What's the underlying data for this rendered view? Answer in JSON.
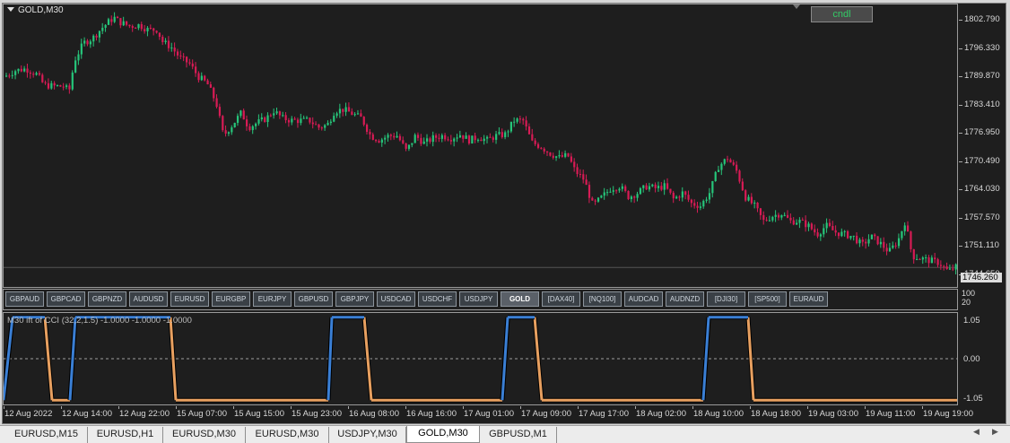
{
  "window": {
    "symbol_title": "GOLD,M30"
  },
  "controls": {
    "cndl_label": "cndl"
  },
  "price_axis": {
    "labels": [
      "1802.790",
      "1796.330",
      "1789.870",
      "1783.410",
      "1776.950",
      "1770.490",
      "1764.030",
      "1757.570",
      "1751.110",
      "1744.650"
    ],
    "current_price": "1746.260"
  },
  "symbol_bar": {
    "buttons": [
      "GBPAUD",
      "GBPCAD",
      "GBPNZD",
      "AUDUSD",
      "EURUSD",
      "EURGBP",
      "EURJPY",
      "GBPUSD",
      "GBPJPY",
      "USDCAD",
      "USDCHF",
      "USDJPY",
      "GOLD",
      "[DAX40]",
      "[NQ100]",
      "AUDCAD",
      "AUDNZD",
      "[DJI30]",
      "[SP500]",
      "EURAUD"
    ],
    "active": "GOLD",
    "axis_top": "100",
    "axis_bottom": "20"
  },
  "indicator": {
    "title": "M30 ift of CCI (32,2,1.5) -1.0000 -1.0000 -1.0000",
    "labels": [
      "1.05",
      "0.00",
      "-1.05"
    ],
    "colors": {
      "up": "#3a7fd5",
      "down": "#e8a060"
    }
  },
  "time_axis": {
    "labels": [
      "12 Aug 2022",
      "12 Aug 14:00",
      "12 Aug 22:00",
      "15 Aug 07:00",
      "15 Aug 15:00",
      "15 Aug 23:00",
      "16 Aug 08:00",
      "16 Aug 16:00",
      "17 Aug 01:00",
      "17 Aug 09:00",
      "17 Aug 17:00",
      "18 Aug 02:00",
      "18 Aug 10:00",
      "18 Aug 18:00",
      "19 Aug 03:00",
      "19 Aug 11:00",
      "19 Aug 19:00"
    ]
  },
  "tabs": {
    "items": [
      "EURUSD,M15",
      "EURUSD,H1",
      "EURUSD,M30",
      "EURUSD,M30",
      "USDJPY,M30",
      "GOLD,M30",
      "GBPUSD,M1"
    ],
    "active_index": 5
  },
  "chart_data": {
    "type": "candlestick",
    "colors": {
      "bull": "#26c57a",
      "bear": "#d81b55"
    },
    "ylim": [
      1744.65,
      1802.79
    ],
    "close_path": [
      [
        0,
        1789.8
      ],
      [
        12,
        1791.2
      ],
      [
        24,
        1791.6
      ],
      [
        36,
        1790.3
      ],
      [
        44,
        1787.9
      ],
      [
        56,
        1787.6
      ],
      [
        66,
        1787.6
      ],
      [
        72,
        1786.5
      ],
      [
        78,
        1793.5
      ],
      [
        88,
        1797.5
      ],
      [
        98,
        1798.5
      ],
      [
        108,
        1800.8
      ],
      [
        116,
        1802.3
      ],
      [
        122,
        1803.3
      ],
      [
        128,
        1802.3
      ],
      [
        140,
        1801.3
      ],
      [
        150,
        1801.6
      ],
      [
        160,
        1800.5
      ],
      [
        170,
        1800.5
      ],
      [
        176,
        1797.8
      ],
      [
        186,
        1796.5
      ],
      [
        196,
        1794.0
      ],
      [
        206,
        1792.8
      ],
      [
        216,
        1789.8
      ],
      [
        226,
        1788.2
      ],
      [
        236,
        1783.8
      ],
      [
        244,
        1776.3
      ],
      [
        254,
        1778.8
      ],
      [
        264,
        1781.6
      ],
      [
        272,
        1778.2
      ],
      [
        282,
        1779.3
      ],
      [
        292,
        1780.3
      ],
      [
        300,
        1782.0
      ],
      [
        310,
        1780.3
      ],
      [
        320,
        1779.8
      ],
      [
        330,
        1779.8
      ],
      [
        340,
        1779.8
      ],
      [
        350,
        1778.2
      ],
      [
        360,
        1778.8
      ],
      [
        368,
        1782.0
      ],
      [
        378,
        1782.3
      ],
      [
        388,
        1781.3
      ],
      [
        398,
        1780.3
      ],
      [
        408,
        1776.3
      ],
      [
        418,
        1775.3
      ],
      [
        428,
        1776.3
      ],
      [
        438,
        1776.3
      ],
      [
        448,
        1772.8
      ],
      [
        458,
        1776.3
      ],
      [
        468,
        1774.6
      ],
      [
        478,
        1775.8
      ],
      [
        488,
        1776.3
      ],
      [
        498,
        1775.8
      ],
      [
        508,
        1776.6
      ],
      [
        518,
        1775.3
      ],
      [
        528,
        1776.0
      ],
      [
        538,
        1775.3
      ],
      [
        548,
        1776.3
      ],
      [
        558,
        1776.6
      ],
      [
        568,
        1779.8
      ],
      [
        578,
        1779.8
      ],
      [
        588,
        1774.8
      ],
      [
        598,
        1773.8
      ],
      [
        608,
        1772.3
      ],
      [
        618,
        1771.3
      ],
      [
        628,
        1771.8
      ],
      [
        636,
        1768.3
      ],
      [
        646,
        1766.3
      ],
      [
        656,
        1760.3
      ],
      [
        666,
        1762.3
      ],
      [
        676,
        1764.3
      ],
      [
        686,
        1764.8
      ],
      [
        696,
        1762.3
      ],
      [
        706,
        1763.3
      ],
      [
        716,
        1764.8
      ],
      [
        726,
        1764.3
      ],
      [
        736,
        1764.8
      ],
      [
        746,
        1761.8
      ],
      [
        756,
        1763.3
      ],
      [
        766,
        1760.8
      ],
      [
        776,
        1760.3
      ],
      [
        786,
        1763.3
      ],
      [
        796,
        1769.3
      ],
      [
        806,
        1771.2
      ],
      [
        816,
        1768.3
      ],
      [
        826,
        1762.3
      ],
      [
        836,
        1760.3
      ],
      [
        846,
        1756.8
      ],
      [
        856,
        1758.0
      ],
      [
        866,
        1758.6
      ],
      [
        876,
        1756.8
      ],
      [
        886,
        1756.8
      ],
      [
        896,
        1755.8
      ],
      [
        906,
        1753.8
      ],
      [
        916,
        1755.8
      ],
      [
        926,
        1754.3
      ],
      [
        936,
        1753.8
      ],
      [
        946,
        1753.3
      ],
      [
        956,
        1751.3
      ],
      [
        966,
        1753.3
      ],
      [
        976,
        1751.8
      ],
      [
        986,
        1749.8
      ],
      [
        996,
        1752.3
      ],
      [
        1004,
        1756.8
      ],
      [
        1012,
        1748.8
      ],
      [
        1022,
        1748.3
      ],
      [
        1032,
        1747.8
      ],
      [
        1042,
        1747.3
      ],
      [
        1052,
        1745.3
      ],
      [
        1060,
        1746.3
      ]
    ],
    "indicator_levels": [
      [
        0,
        -1.05
      ],
      [
        10,
        1.05
      ],
      [
        46,
        1.05
      ],
      [
        54,
        -1.05
      ],
      [
        74,
        -1.05
      ],
      [
        80,
        1.05
      ],
      [
        186,
        1.05
      ],
      [
        192,
        -1.05
      ],
      [
        362,
        -1.05
      ],
      [
        366,
        1.05
      ],
      [
        402,
        1.05
      ],
      [
        410,
        -1.05
      ],
      [
        556,
        -1.05
      ],
      [
        562,
        1.05
      ],
      [
        592,
        1.05
      ],
      [
        600,
        -1.05
      ],
      [
        780,
        -1.05
      ],
      [
        786,
        1.05
      ],
      [
        830,
        1.05
      ],
      [
        836,
        -1.05
      ],
      [
        1065,
        -1.05
      ]
    ]
  }
}
